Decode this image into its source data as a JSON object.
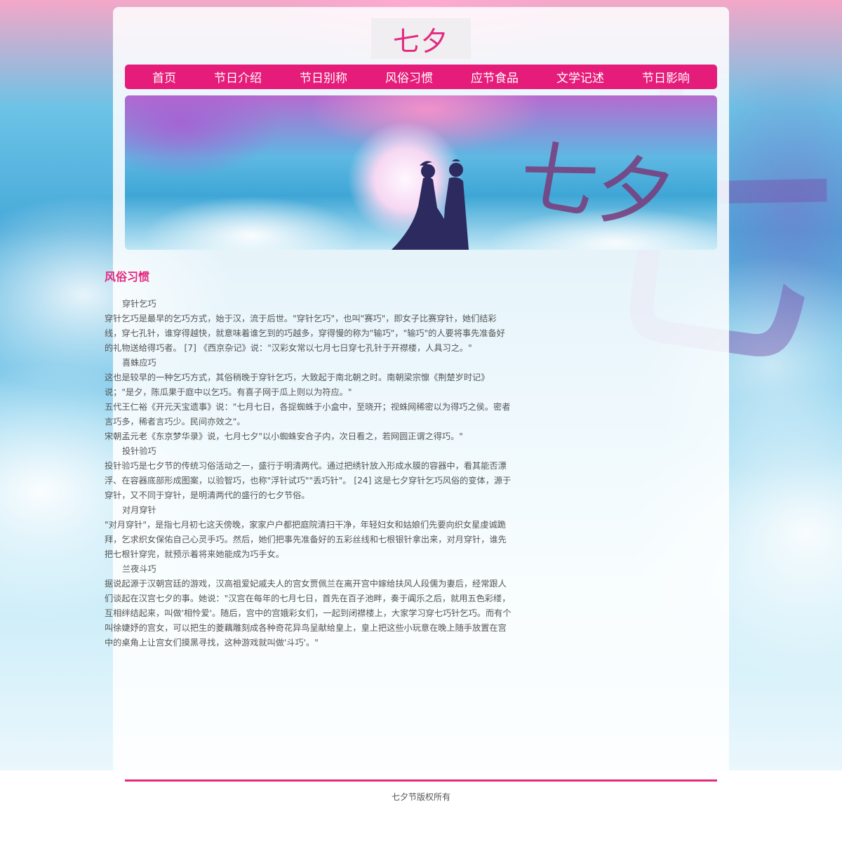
{
  "logo": {
    "text": "七夕"
  },
  "nav": {
    "items": [
      "首页",
      "节日介绍",
      "节日别称",
      "风俗习惯",
      "应节食品",
      "文学记述",
      "节日影响"
    ]
  },
  "banner": {
    "glyph": "七夕"
  },
  "article": {
    "title": "风俗习惯",
    "paragraphs": [
      "穿针乞巧",
      "穿针乞巧是最早的乞巧方式，始于汉，流于后世。\"穿针乞巧\"，也叫\"赛巧\"，即女子比赛穿针，她们结彩线，穿七孔针，谁穿得越快，就意味着谁乞到的巧越多，穿得慢的称为\"输巧\"，\"输巧\"的人要将事先准备好的礼物送给得巧者。 [7] 《西京杂记》说：\"汉彩女常以七月七日穿七孔针于开襟楼，人具习之。\"",
      "喜蛛应巧",
      "这也是较早的一种乞巧方式，其俗稍晚于穿针乞巧，大致起于南北朝之时。南朝梁宗懔《荆楚岁时记》说；\"是夕，陈瓜果于庭中以乞巧。有喜子网于瓜上则以为符应。\"",
      "五代王仁裕《开元天宝遗事》说：\"七月七日，各捉蜘蛛于小盒中，至晓开；视蛛网稀密以为得巧之侯。密者言巧多，稀者言巧少。民间亦效之\"。",
      "宋朝孟元老《东京梦华录》说，七月七夕\"以小蜘蛛安合子内，次日看之，若网圆正谓之得巧。\"",
      "投针验巧",
      "投针验巧是七夕节的传统习俗活动之一，盛行于明清两代。通过把绣针放入形成水膜的容器中，看其能否漂浮、在容器底部形成图案，以验智巧，也称\"浮针试巧\"\"丢巧针\"。 [24] 这是七夕穿针乞巧风俗的变体，源于穿针，又不同于穿针，是明清两代的盛行的七夕节俗。",
      "对月穿针",
      "\"对月穿针\"，是指七月初七这天傍晚，家家户户都把庭院清扫干净，年轻妇女和姑娘们先要向织女星虔诚跪拜，乞求织女保佑自己心灵手巧。然后，她们把事先准备好的五彩丝线和七根银针拿出来，对月穿针，谁先把七根针穿完，就预示着将来她能成为巧手女。",
      "兰夜斗巧",
      "据说起源于汉朝宫廷的游戏，汉高祖爱妃戚夫人的宫女贾佩兰在离开宫中嫁给扶风人段儒为妻后，经常跟人们谈起在汉宫七夕的事。她说：\"汉宫在每年的七月七日，首先在百子池畔，奏于阗乐之后，就用五色彩缕，互相绊结起来，叫做'相怜爱'。随后，宫中的宫娥彩女们，一起到闭襟楼上，大家学习穿七巧针乞巧。而有个叫徐婕妤的宫女，可以把生的菱藕雕刻成各种奇花异鸟呈献给皇上，皇上把这些小玩意在晚上随手放置在宫中的桌角上让宫女们摸黑寻找，这种游戏就叫做'斗巧'。\""
    ]
  },
  "footer": {
    "copyright": "七夕节版权所有"
  },
  "colors": {
    "accent": "#e61c7a",
    "text": "#555555"
  }
}
